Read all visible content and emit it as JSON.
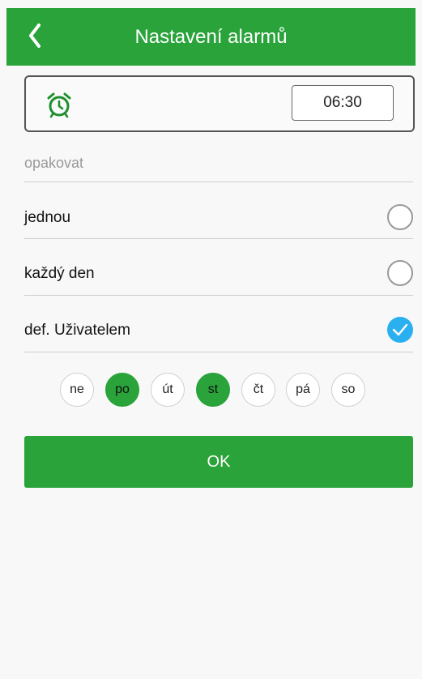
{
  "header": {
    "title": "Nastavení alarmů",
    "back_icon": "chevron-left-icon"
  },
  "alarm": {
    "icon": "alarm-clock-icon",
    "time": "06:30"
  },
  "repeat": {
    "label": "opakovat",
    "options": [
      {
        "label": "jednou",
        "selected": false
      },
      {
        "label": "každý den",
        "selected": false
      },
      {
        "label": "def. Uživatelem",
        "selected": true
      }
    ]
  },
  "days": [
    {
      "label": "ne",
      "active": false
    },
    {
      "label": "po",
      "active": true
    },
    {
      "label": "út",
      "active": false
    },
    {
      "label": "st",
      "active": true
    },
    {
      "label": "čt",
      "active": false
    },
    {
      "label": "pá",
      "active": false
    },
    {
      "label": "so",
      "active": false
    }
  ],
  "ok_button": {
    "label": "OK"
  },
  "colors": {
    "accent_green": "#29a33a",
    "check_blue": "#2ab0f0"
  }
}
